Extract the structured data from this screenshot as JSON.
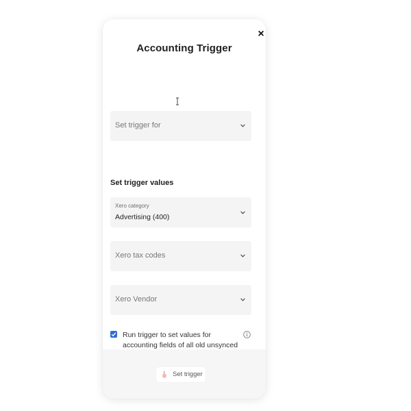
{
  "modal": {
    "title": "Accounting Trigger",
    "close_symbol": "×"
  },
  "trigger_for": {
    "placeholder": "Set trigger for"
  },
  "section": {
    "heading": "Set trigger values"
  },
  "xero_category": {
    "label": "Xero category",
    "value": "Advertising (400)"
  },
  "xero_tax_codes": {
    "placeholder": "Xero tax codes"
  },
  "xero_vendor": {
    "placeholder": "Xero Vendor"
  },
  "run_old_option": {
    "checked": true,
    "label": "Run trigger to set values for accounting fields of all old unsynced transactions."
  },
  "footer": {
    "submit_label": "Set trigger"
  },
  "icons": {
    "close": "close-icon",
    "chevron": "chevron-down-icon",
    "info": "info-icon",
    "check": "checkmark-icon",
    "button": "hand-pointer-icon",
    "cursor": "text-cursor-icon"
  },
  "colors": {
    "accent": "#2f6fd6",
    "title": "#1f1f1f",
    "field_bg": "#f4f4f4",
    "modal_footer_bg": "#f6f6f6"
  }
}
